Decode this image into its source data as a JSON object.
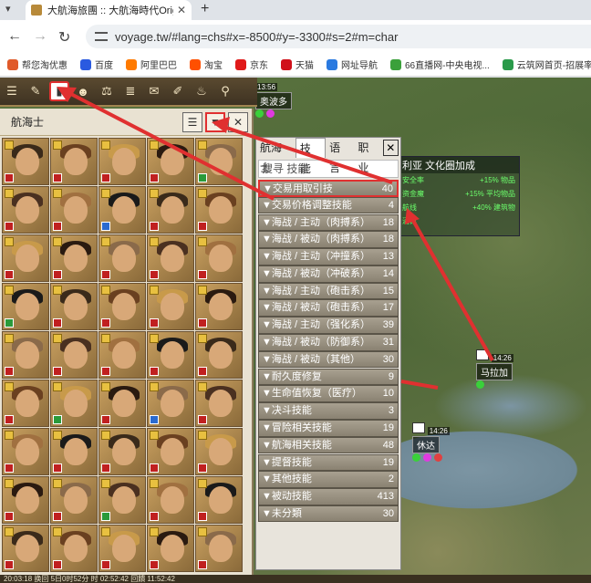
{
  "browser": {
    "tab_title": "大航海旅團 :: 大航海時代Origin",
    "url": "voyage.tw/#lang=chs#x=-8500#y=-3300#s=2#m=char"
  },
  "bookmarks": [
    {
      "label": "帮您淘优惠",
      "color": "#e05a2a"
    },
    {
      "label": "百度",
      "color": "#2a5ae0"
    },
    {
      "label": "阿里巴巴",
      "color": "#ff7a00"
    },
    {
      "label": "淘宝",
      "color": "#ff5000"
    },
    {
      "label": "京东",
      "color": "#e01a1a"
    },
    {
      "label": "天猫",
      "color": "#d0101a"
    },
    {
      "label": "网址导航",
      "color": "#2a7ae0"
    },
    {
      "label": "66直播网-中央电视...",
      "color": "#3aa03a"
    },
    {
      "label": "云筑网首页-招展率...",
      "color": "#2a9a4a"
    }
  ],
  "side_panel": {
    "title": "航海士"
  },
  "skill_panel": {
    "tabs": [
      "航海士",
      "技能",
      "语言",
      "职业"
    ],
    "active_tab": "技能",
    "search_text": "搜寻 技能",
    "rows": [
      {
        "label": "▼交易用取引技",
        "count": "40",
        "highlight": true
      },
      {
        "label": "▼交易价格调整技能",
        "count": "4"
      },
      {
        "label": "▼海战 / 主动（肉搏系）",
        "count": "18"
      },
      {
        "label": "▼海战 / 被动（肉搏系）",
        "count": "18"
      },
      {
        "label": "▼海战 / 主动（冲撞系）",
        "count": "13"
      },
      {
        "label": "▼海战 / 被动（冲破系）",
        "count": "14"
      },
      {
        "label": "▼海战 / 主动（砲击系）",
        "count": "15"
      },
      {
        "label": "▼海战 / 被动（砲击系）",
        "count": "17"
      },
      {
        "label": "▼海战 / 主动（强化系）",
        "count": "39"
      },
      {
        "label": "▼海战 / 被动（防御系）",
        "count": "31"
      },
      {
        "label": "▼海战 / 被动（其他）",
        "count": "30"
      },
      {
        "label": "▼耐久度修复",
        "count": "9"
      },
      {
        "label": "▼生命值恢复（医疗）",
        "count": "10"
      },
      {
        "label": "▼决斗技能",
        "count": "3"
      },
      {
        "label": "▼冒险相关技能",
        "count": "19"
      },
      {
        "label": "▼航海相关技能",
        "count": "48"
      },
      {
        "label": "▼提督技能",
        "count": "19"
      },
      {
        "label": "▼其他技能",
        "count": "2"
      },
      {
        "label": "▼被动技能",
        "count": "413"
      },
      {
        "label": "▼未分類",
        "count": "30"
      }
    ]
  },
  "alliance": {
    "title": "利亚 文化圈加成",
    "rows": [
      [
        "安全率",
        "+15% 物品"
      ],
      [
        "资金魔",
        "+15% 平均物品"
      ],
      [
        "航线",
        "+40% 建筑物"
      ],
      [
        "酒馆",
        ""
      ]
    ]
  },
  "towns": [
    {
      "time": "13:56",
      "name": "奥波多"
    },
    {
      "time": "14:26",
      "name": "马拉加"
    },
    {
      "time": "14:26",
      "name": "休达"
    }
  ],
  "status_bar": "20:03:18  换回 5日0时52分  时 02:52:42  回饋 11:52:42"
}
